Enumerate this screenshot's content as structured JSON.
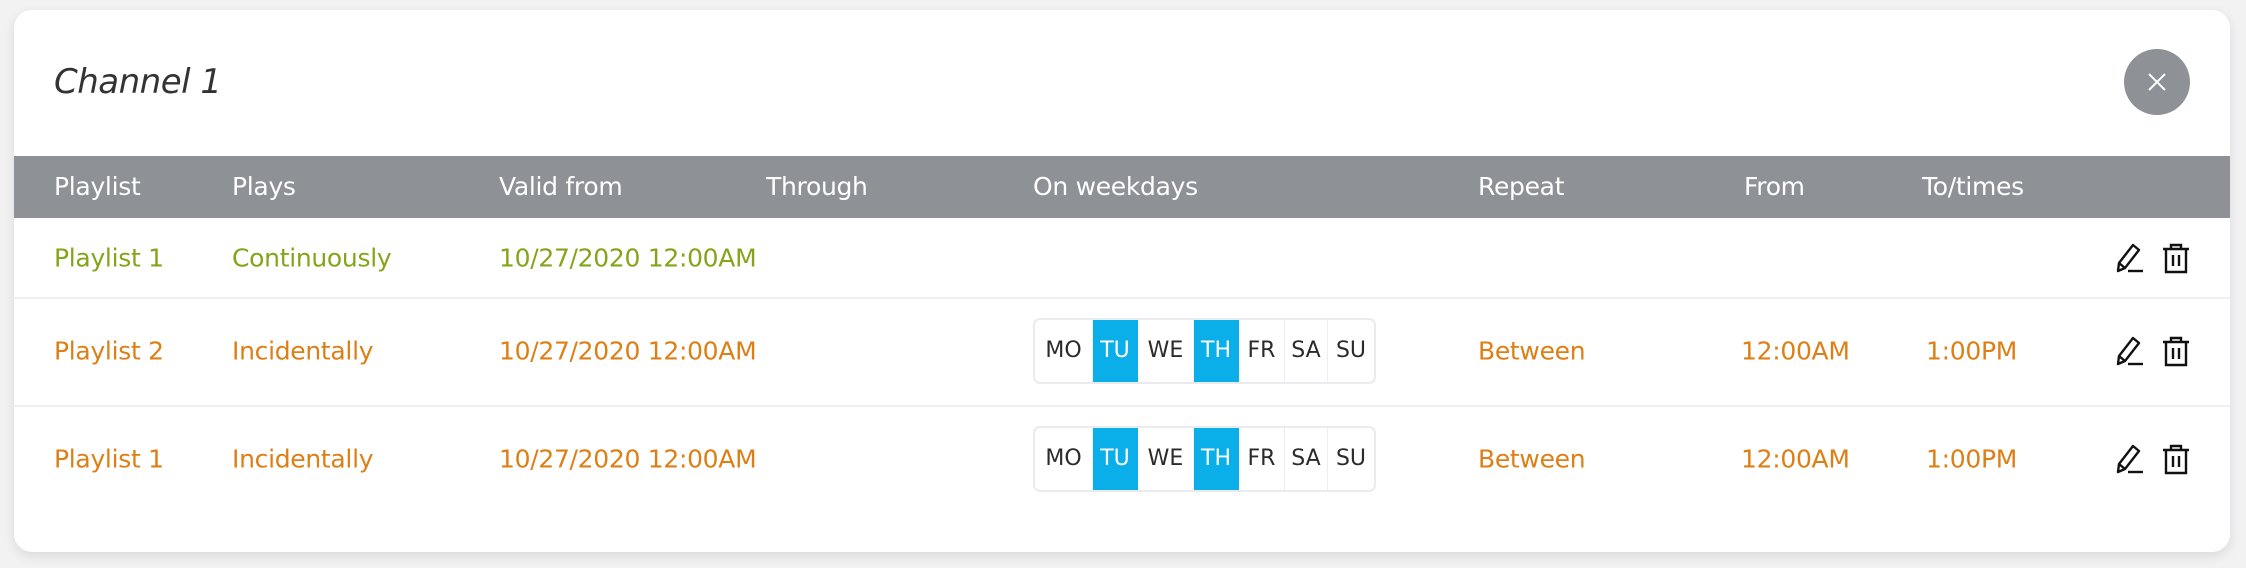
{
  "dialog": {
    "title": "Channel 1",
    "close_icon": "close-icon"
  },
  "colors": {
    "header_bg": "#8e9196",
    "continuous": "#84a51a",
    "incidental": "#dd7f15",
    "day_selected": "#0aaee8"
  },
  "table": {
    "headers": [
      "Playlist",
      "Plays",
      "Valid from",
      "Through",
      "On weekdays",
      "Repeat",
      "From",
      "To/times"
    ],
    "rows": [
      {
        "playlist": "Playlist 1",
        "plays": "Continuously",
        "valid_from": "10/27/2020 12:00AM",
        "through": "",
        "weekdays": null,
        "repeat": "",
        "from": "",
        "to": "",
        "actions": [
          "edit-icon",
          "delete-icon"
        ]
      },
      {
        "playlist": "Playlist 2",
        "plays": "Incidentally",
        "valid_from": "10/27/2020 12:00AM",
        "through": "",
        "weekdays": [
          {
            "label": "MO",
            "selected": false
          },
          {
            "label": "TU",
            "selected": true
          },
          {
            "label": "WE",
            "selected": false
          },
          {
            "label": "TH",
            "selected": true
          },
          {
            "label": "FR",
            "selected": false
          },
          {
            "label": "SA",
            "selected": false
          },
          {
            "label": "SU",
            "selected": false
          }
        ],
        "repeat": "Between",
        "from": "12:00AM",
        "to": "1:00PM",
        "actions": [
          "edit-icon",
          "delete-icon"
        ]
      },
      {
        "playlist": "Playlist 1",
        "plays": "Incidentally",
        "valid_from": "10/27/2020 12:00AM",
        "through": "",
        "weekdays": [
          {
            "label": "MO",
            "selected": false
          },
          {
            "label": "TU",
            "selected": true
          },
          {
            "label": "WE",
            "selected": false
          },
          {
            "label": "TH",
            "selected": true
          },
          {
            "label": "FR",
            "selected": false
          },
          {
            "label": "SA",
            "selected": false
          },
          {
            "label": "SU",
            "selected": false
          }
        ],
        "repeat": "Between",
        "from": "12:00AM",
        "to": "1:00PM",
        "actions": [
          "edit-icon",
          "delete-icon"
        ]
      }
    ]
  }
}
